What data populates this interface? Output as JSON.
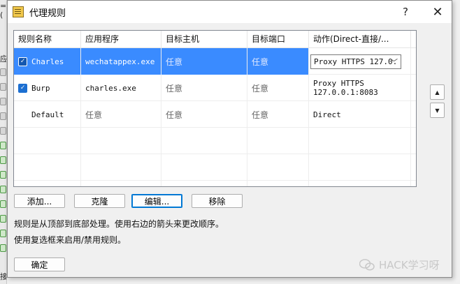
{
  "dialog": {
    "title": "代理规则",
    "help_label": "?",
    "close_label": "✕"
  },
  "background": {
    "texts": [
      "=(",
      "应",
      "接"
    ]
  },
  "table": {
    "columns": [
      "规则名称",
      "应用程序",
      "目标主机",
      "目标端口",
      "动作(Direct-直接/..."
    ],
    "rows": [
      {
        "enabled": true,
        "name": "Charles",
        "app": "wechatappex.exe",
        "host": "任意",
        "port": "任意",
        "action": "Proxy HTTPS 127.0.",
        "selected": true
      },
      {
        "enabled": true,
        "name": "Burp",
        "app": "charles.exe",
        "host": "任意",
        "port": "任意",
        "action": "Proxy HTTPS 127.0.0.1:8083",
        "selected": false
      },
      {
        "enabled": false,
        "name": "Default",
        "app": "任意",
        "host": "任意",
        "port": "任意",
        "action": "Direct",
        "selected": false
      }
    ]
  },
  "arrows": {
    "up": "▲",
    "down": "▼"
  },
  "buttons": {
    "add": "添加...",
    "clone": "克隆",
    "edit": "编辑...",
    "remove": "移除",
    "ok": "确定"
  },
  "hints": {
    "line1": "规则是从顶部到底部处理。使用右边的箭头来更改顺序。",
    "line2": "使用复选框来启用/禁用规则。"
  },
  "watermark": {
    "text": "HACK学习呀"
  },
  "colors": {
    "selection": "#3a8bff",
    "checkbox": "#1c6fd1",
    "focus": "#0078d4"
  }
}
